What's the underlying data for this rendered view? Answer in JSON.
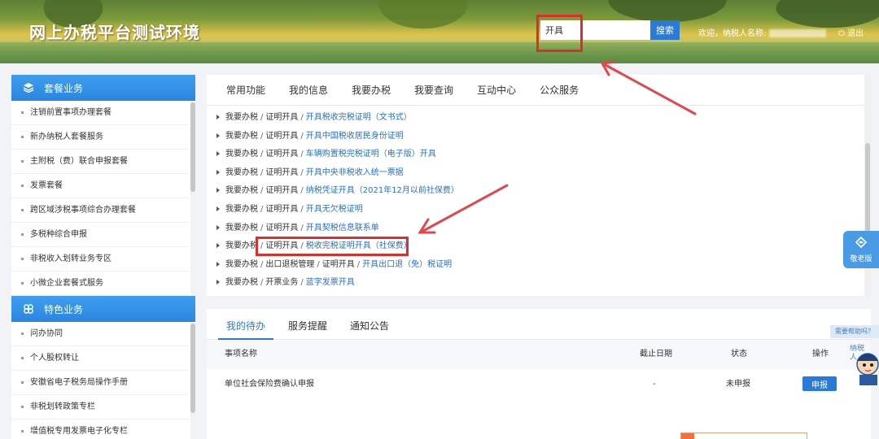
{
  "header": {
    "site_title": "网上办税平台测试环境",
    "search_value": "开具",
    "search_button": "搜索",
    "welcome_text": "欢迎，纳税人名称:",
    "logout_label": "退出"
  },
  "sidebar": {
    "section1": {
      "title": "套餐业务",
      "items": [
        "注销前置事项办理套餐",
        "新办纳税人套餐服务",
        "主附税（费）联合申报套餐",
        "发票套餐",
        "跨区域涉税事项综合办理套餐",
        "多税种综合申报",
        "非税收入划转业务专区",
        "小微企业套餐式服务"
      ]
    },
    "section2": {
      "title": "特色业务",
      "items": [
        "问办协同",
        "个人股权转让",
        "安徽省电子税务局操作手册",
        "非税划转政策专栏",
        "增值税专用发票电子化专栏"
      ]
    }
  },
  "main_tabs": [
    "常用功能",
    "我的信息",
    "我要办税",
    "我要查询",
    "互动中心",
    "公众服务"
  ],
  "search_results": [
    {
      "path": [
        "我要办税",
        "证明开具"
      ],
      "target": "开具税收完税证明（文书式）"
    },
    {
      "path": [
        "我要办税",
        "证明开具"
      ],
      "target": "开具中国税收居民身份证明"
    },
    {
      "path": [
        "我要办税",
        "证明开具"
      ],
      "target": "车辆购置税完税证明（电子版）开具"
    },
    {
      "path": [
        "我要办税",
        "证明开具"
      ],
      "target": "开具中央非税收入统一票据"
    },
    {
      "path": [
        "我要办税",
        "证明开具"
      ],
      "target": "纳税凭证开具（2021年12月以前社保费）"
    },
    {
      "path": [
        "我要办税",
        "证明开具"
      ],
      "target": "开具无欠税证明"
    },
    {
      "path": [
        "我要办税",
        "证明开具"
      ],
      "target": "开具契税信息联系单"
    },
    {
      "path": [
        "我要办税",
        "证明开具"
      ],
      "target": "税收完税证明开具（社保费）"
    },
    {
      "path": [
        "我要办税",
        "出口退税管理",
        "证明开具"
      ],
      "target": "开具出口退（免）税证明"
    },
    {
      "path": [
        "我要办税",
        "开票业务"
      ],
      "target": "蓝字发票开具"
    }
  ],
  "todo": {
    "tabs": [
      "我的待办",
      "服务提醒",
      "通知公告"
    ],
    "columns": {
      "name": "事项名称",
      "deadline": "截止日期",
      "status": "状态",
      "action": "操作"
    },
    "rows": [
      {
        "name": "单位社会保险费确认申报",
        "deadline": "-",
        "status": "未申报",
        "action": "申报"
      }
    ]
  },
  "widgets": {
    "elder_mode": "敬老版",
    "help": "需要帮助吗？",
    "mascot_label": "纳税人"
  },
  "colors": {
    "accent": "#2a7ad8",
    "highlight": "#d9302b",
    "link": "#2a6fc9"
  }
}
